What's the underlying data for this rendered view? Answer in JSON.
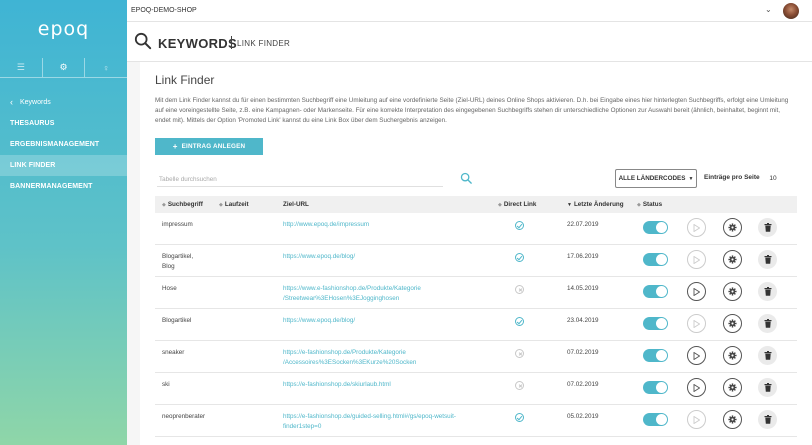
{
  "sidebar": {
    "logo": "epoq",
    "tabs": [
      {
        "icon": "menu-icon",
        "glyph": "☰"
      },
      {
        "icon": "gear-icon",
        "glyph": "⚙"
      },
      {
        "icon": "bulb-icon",
        "glyph": "♀"
      }
    ],
    "back_label": "Keywords",
    "items": [
      {
        "label": "THESAURUS"
      },
      {
        "label": "ERGEBNISMANAGEMENT"
      },
      {
        "label": "LINK FINDER",
        "active": true
      },
      {
        "label": "BANNERMANAGEMENT"
      }
    ]
  },
  "topbar": {
    "shop_name": "EPOQ-DEMO-SHOP",
    "chevron": "⌄"
  },
  "header": {
    "title": "KEYWORDS",
    "subtitle": "LINK FINDER"
  },
  "main": {
    "page_title": "Link Finder",
    "description": "Mit dem Link Finder kannst du für einen bestimmten Suchbegriff eine Umleitung auf eine vordefinierte Seite (Ziel-URL) deines Online Shops aktivieren. D.h. bei Eingabe eines hier hinterlegten Suchbegriffs, erfolgt eine Umleitung auf eine voreingestellte Seite, z.B. eine Kampagnen- oder Markenseite. Für eine korrekte Interpretation des eingegebenen Suchbegriffs stehen dir unterschiedliche Optionen zur Auswahl bereit (ähnlich, beinhaltet, beginnt mit, endet mit). Mittels der Option 'Promoted Link' kannst du eine Link Box über dem Suchergebnis anzeigen.",
    "add_button": "EINTRAG ANLEGEN",
    "search_placeholder": "Tabelle durchsuchen",
    "country_button": "ALLE LÄNDERCODES",
    "per_page_label": "Einträge pro Seite",
    "per_page_value": "10"
  },
  "table": {
    "headers": {
      "suchbegriff": "Suchbegriff",
      "laufzeit": "Laufzeit",
      "ziel_url": "Ziel-URL",
      "direct_link": "Direct Link",
      "letzte_aenderung": "Letzte Änderung",
      "status": "Status"
    },
    "rows": [
      {
        "term": "impressum",
        "url": "http://www.epoq.de/impressum",
        "direct": true,
        "date": "22.07.2019",
        "status": true
      },
      {
        "term": "Blogartikel,\nBlog",
        "url": "https://www.epoq.de/blog/",
        "direct": true,
        "date": "17.06.2019",
        "status": true
      },
      {
        "term": "Hose",
        "url": "https://www.e-fashionshop.de/Produkte/Kategorie\n/Streetwear%3EHosen%3EJogginghosen",
        "direct": false,
        "date": "14.05.2019",
        "status": true
      },
      {
        "term": "Blogartikel",
        "url": "https://www.epoq.de/blog/",
        "direct": true,
        "date": "23.04.2019",
        "status": true
      },
      {
        "term": "sneaker",
        "url": "https://e-fashionshop.de/Produkte/Kategorie\n/Accessoires%3ESocken%3EKurze%20Socken",
        "direct": false,
        "date": "07.02.2019",
        "status": true
      },
      {
        "term": "ski",
        "url": "https://e-fashionshop.de/skiurlaub.html",
        "direct": false,
        "date": "07.02.2019",
        "status": true
      },
      {
        "term": "neoprenberater",
        "url": "https://e-fashionshop.de/guided-selling.html#/gs/epoq-wetsuit-\nfinder1step=0",
        "direct": true,
        "date": "05.02.2019",
        "status": true
      }
    ]
  }
}
